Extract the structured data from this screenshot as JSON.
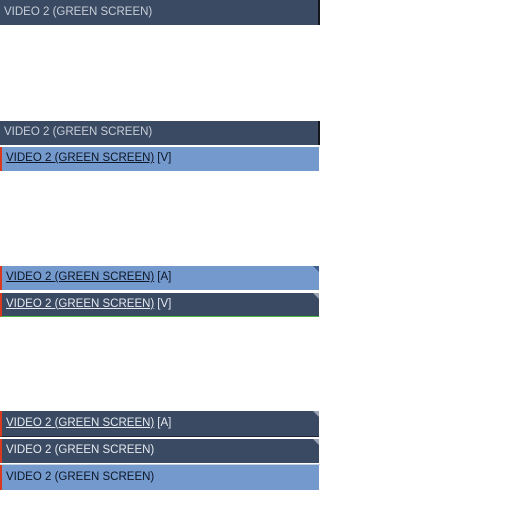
{
  "clips": {
    "c1": {
      "label": "VIDEO 2 (GREEN SCREEN)"
    },
    "c2": {
      "label": "VIDEO 2 (GREEN SCREEN)"
    },
    "c3": {
      "label": "VIDEO 2 (GREEN SCREEN)",
      "suffix": "[V]"
    },
    "c4": {
      "label": "VIDEO 2 (GREEN SCREEN)",
      "suffix": "[A]"
    },
    "c5": {
      "label": "VIDEO 2 (GREEN SCREEN)",
      "suffix": "[V]"
    },
    "c6": {
      "label": "VIDEO 2 (GREEN SCREEN)",
      "suffix": "[A]"
    },
    "c7": {
      "label": "VIDEO 2 (GREEN SCREEN)"
    },
    "c8": {
      "label": "VIDEO 2 (GREEN SCREEN)"
    }
  },
  "colors": {
    "clip_dark": "#3a4a62",
    "clip_light": "#7399cd",
    "selection_edge": "#d93a1f",
    "video_track_line": "#49b845"
  }
}
